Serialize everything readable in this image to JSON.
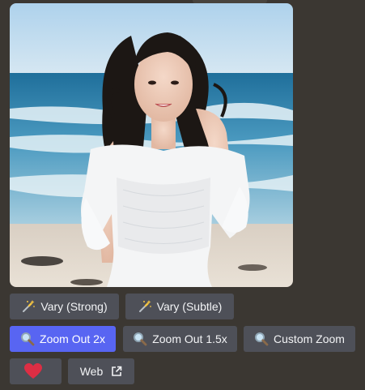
{
  "image": {
    "alt": ""
  },
  "buttons": {
    "row1": [
      {
        "label": "Vary (Strong)",
        "icon": "magic-wand-icon"
      },
      {
        "label": "Vary (Subtle)",
        "icon": "magic-wand-icon"
      }
    ],
    "row2": [
      {
        "label": "Zoom Out 2x",
        "icon": "magnifier-icon",
        "state": "selected"
      },
      {
        "label": "Zoom Out 1.5x",
        "icon": "magnifier-icon"
      },
      {
        "label": "Custom Zoom",
        "icon": "magnifier-icon"
      }
    ],
    "row3": [
      {
        "label": "",
        "icon": "heart-icon"
      },
      {
        "label": "Web",
        "icon": "external-link-icon"
      }
    ]
  },
  "colors": {
    "background": "#3b3732",
    "button": "#4e5058",
    "primary_button": "#5865f2",
    "heart": "#dd2e44"
  }
}
